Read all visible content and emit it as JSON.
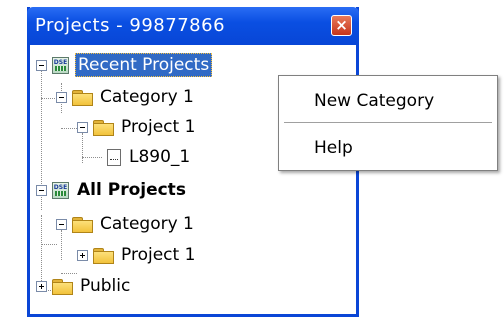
{
  "window": {
    "title": "Projects - 99877866",
    "close_label": "×"
  },
  "tree": {
    "recent_projects": {
      "label": "Recent Projects",
      "icon": "dse-icon",
      "expanded": true,
      "selected": true,
      "category": {
        "label": "Category 1",
        "project": {
          "label": "Project 1",
          "file": {
            "label": "L890_1"
          }
        }
      }
    },
    "all_projects": {
      "label": "All Projects",
      "icon": "dse-icon",
      "category": {
        "label": "Category 1",
        "project": {
          "label": "Project 1",
          "expanded": false
        }
      },
      "public": {
        "label": "Public",
        "expanded": false
      }
    },
    "dse_badge": "DSE"
  },
  "context_menu": {
    "items": [
      {
        "label": "New Category"
      },
      {
        "label": "Help"
      }
    ]
  },
  "colors": {
    "titlebar": "#0a4fe2",
    "selection": "#316ac5",
    "folder": "#f2c23b"
  }
}
